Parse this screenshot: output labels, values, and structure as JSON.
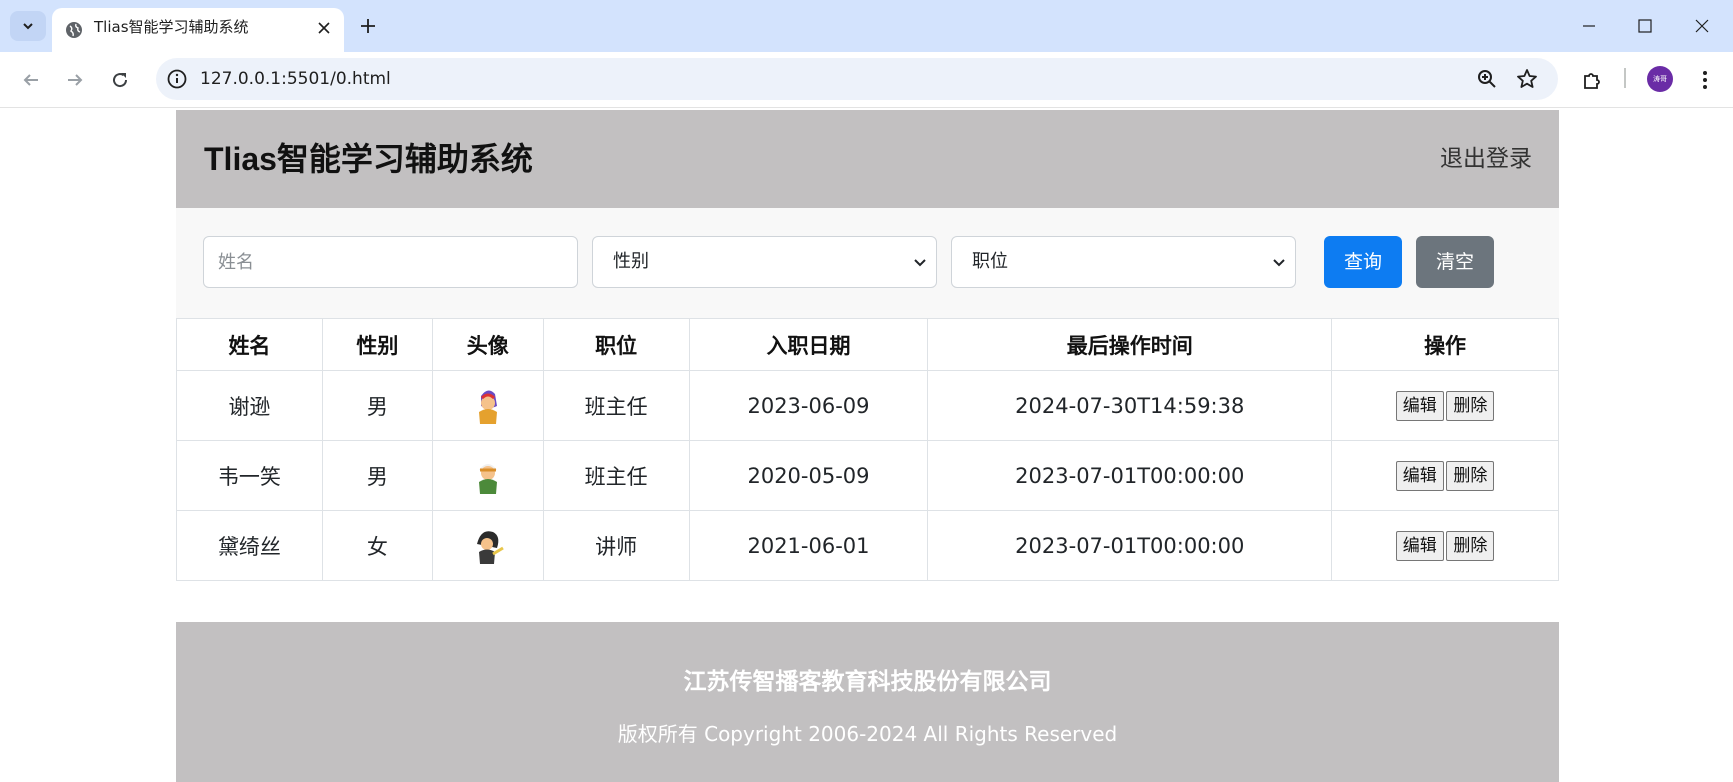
{
  "browser": {
    "tab_title": "Tlias智能学习辅助系统",
    "url": "127.0.0.1:5501/0.html",
    "profile_initials": "涛哥"
  },
  "header": {
    "title": "Tlias智能学习辅助系统",
    "logout_label": "退出登录"
  },
  "search": {
    "name_placeholder": "姓名",
    "gender_select_value": "性别",
    "job_select_value": "职位",
    "query_label": "查询",
    "clear_label": "清空"
  },
  "table": {
    "columns": [
      "姓名",
      "性别",
      "头像",
      "职位",
      "入职日期",
      "最后操作时间",
      "操作"
    ],
    "rows": [
      {
        "name": "谢逊",
        "gender": "男",
        "avatar": "avatar-image",
        "job": "班主任",
        "entry_date": "2023-06-09",
        "update_time": "2024-07-30T14:59:38",
        "edit_label": "编辑",
        "delete_label": "删除"
      },
      {
        "name": "韦一笑",
        "gender": "男",
        "avatar": "avatar-image",
        "job": "班主任",
        "entry_date": "2020-05-09",
        "update_time": "2023-07-01T00:00:00",
        "edit_label": "编辑",
        "delete_label": "删除"
      },
      {
        "name": "黛绮丝",
        "gender": "女",
        "avatar": "avatar-image",
        "job": "讲师",
        "entry_date": "2021-06-01",
        "update_time": "2023-07-01T00:00:00",
        "edit_label": "编辑",
        "delete_label": "删除"
      }
    ]
  },
  "footer": {
    "company": "江苏传智播客教育科技股份有限公司",
    "copyright": "版权所有 Copyright 2006-2024 All Rights Reserved"
  },
  "colors": {
    "header_bg": "#c2c0c1",
    "query_button": "#0d7cf2",
    "clear_button": "#6c757d"
  }
}
